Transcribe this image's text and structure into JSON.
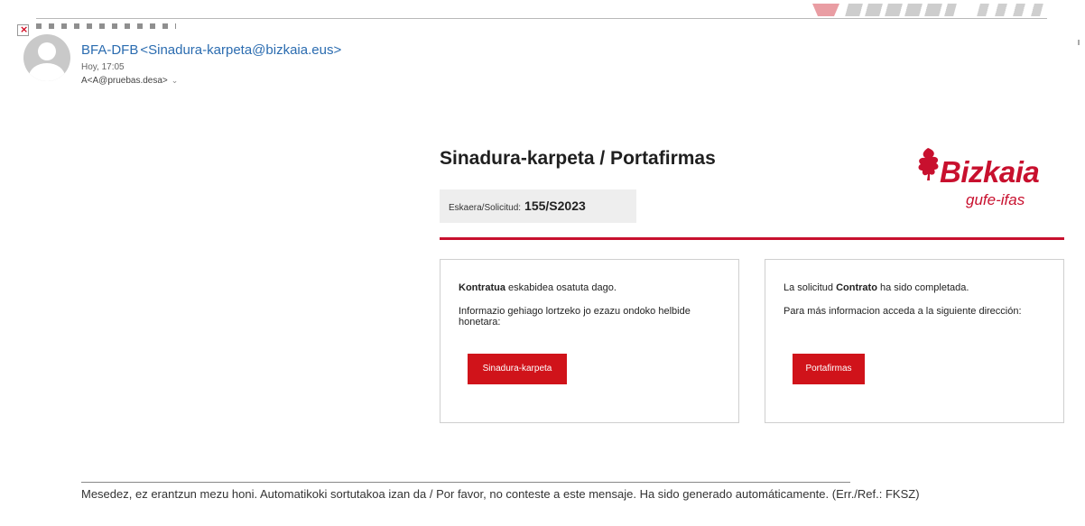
{
  "message": {
    "sender_name": "BFA-DFB",
    "sender_address": "<Sinadura-karpeta@bizkaia.eus>",
    "time": "Hoy, 17:05",
    "to": "A<A@pruebas.desa>",
    "expand_icon": "double-chevron-down-icon"
  },
  "header": {
    "title": "Sinadura-karpeta / Portafirmas",
    "request_label": "Eskaera/Solicitud:",
    "request_value": "155/S2023"
  },
  "logo": {
    "name": "Bizkaia",
    "subtitle": "gufe-ifas",
    "color": "#c8102e"
  },
  "accent_color": "#c8102e",
  "cards": {
    "basque": {
      "bold": "Kontratua",
      "line1_rest": " eskabidea osatuta dago.",
      "line2": "Informazio gehiago lortzeko jo ezazu ondoko helbide honetara:",
      "button": "Sinadura-karpeta"
    },
    "spanish": {
      "line1_pre": "La solicitud ",
      "bold": "Contrato",
      "line1_rest": " ha sido completada.",
      "line2": "Para más informacion acceda a la siguiente dirección:",
      "button": "Portafirmas"
    }
  },
  "footer": {
    "text": "Mesedez, ez erantzun mezu honi. Automatikoki sortutakoa izan da / Por favor, no conteste a este mensaje. Ha sido generado automáticamente. (Err./Ref.: FKSZ)"
  }
}
